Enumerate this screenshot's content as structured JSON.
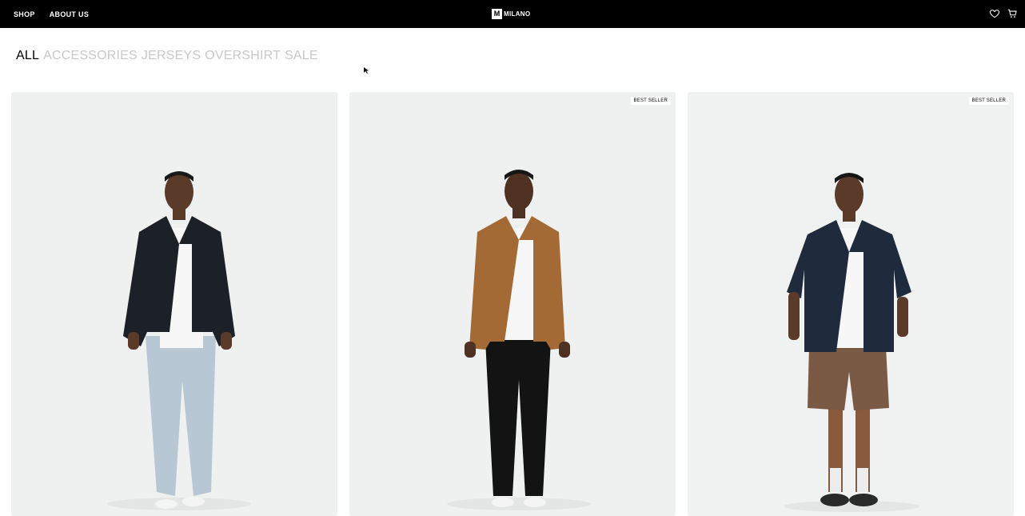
{
  "header": {
    "nav_left": [
      "SHOP",
      "ABOUT US"
    ],
    "logo": {
      "mark": "M",
      "text": "MILANO"
    },
    "icons": [
      "heart-icon",
      "cart-icon"
    ]
  },
  "categories": {
    "items": [
      "ALL",
      "ACCESSORIES",
      "JERSEYS",
      "OVERSHIRT",
      "SALE"
    ],
    "active": "ALL"
  },
  "products": [
    {
      "badge": "",
      "model": "black jacket, white tee, light blue jeans"
    },
    {
      "badge": "BEST SELLER",
      "model": "tan corduroy shirt, white tee, black trousers"
    },
    {
      "badge": "BEST SELLER",
      "model": "navy short-sleeve shirt, brown corduroy shorts"
    }
  ],
  "colors": {
    "header_bg": "#000000",
    "card_bg": "#eff1f0",
    "inactive_category": "#c8c8c8"
  }
}
